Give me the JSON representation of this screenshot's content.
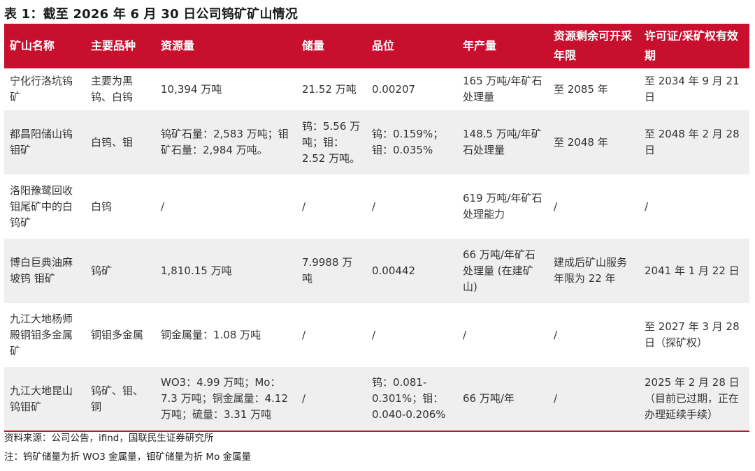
{
  "title": "表 1：截至 2026 年 6 月 30 日公司钨矿矿山情况",
  "table": {
    "headers": [
      "矿山名称",
      "主要品种",
      "资源量",
      "储量",
      "品位",
      "年产量",
      "资源剩余可开采年限",
      "许可证/采矿权有效期"
    ],
    "rows": [
      [
        "宁化行洛坑钨矿",
        "主要为黑钨、白钨",
        "10,394 万吨",
        "21.52 万吨",
        "0.00207",
        "165 万吨/年矿石处理量",
        "至 2085 年",
        "至 2034 年 9 月 21 日"
      ],
      [
        "都昌阳储山钨钼矿",
        "白钨、钼",
        "钨矿石量：2,583 万吨；钼矿石量：2,984 万吨。",
        "钨：5.56 万吨；钼：2.52 万吨。",
        "钨：0.159%；钼：0.035%",
        "148.5 万吨/年矿石处理量",
        "至 2048 年",
        "至 2048 年 2 月 28 日"
      ],
      [
        "洛阳豫鹭回收钼尾矿中的白 钨矿",
        "白钨",
        "/",
        "/",
        "/",
        "619 万吨/年矿石处理能力",
        "/",
        "/"
      ],
      [
        "博白巨典油麻坡钨 钼矿",
        "钨矿",
        "1,810.15 万吨",
        "7.9988 万吨",
        "0.00442",
        "66 万吨/年矿石处理量 (在建矿山)",
        "建成后矿山服务年限为 22 年",
        "2041 年 1 月 22 日"
      ],
      [
        "九江大地杨师殿铜钼多金属矿",
        "铜钼多金属",
        "铜金属量：1.08 万吨",
        "/",
        "/",
        "/",
        "/",
        "至 2027 年 3 月 28 日（探矿权）"
      ],
      [
        "九江大地昆山钨钼矿",
        "钨矿、钼、铜",
        "WO3：4.99 万吨；Mo：7.3 万吨；铜金属量：4.12 万吨；硫量：3.31 万吨",
        "/",
        "钨：0.081-0.301%；钼：0.040-0.206%",
        "66 万吨/年",
        "/",
        "2025 年 2 月 28 日（目前已过期，正在办理延续手续）"
      ]
    ]
  },
  "source": "资料来源：公司公告，ifind，国联民生证券研究所",
  "note": "注：钨矿储量为折 WO3 金属量，钼矿储量为折 Mo 金属量",
  "colors": {
    "header_bg": "#c8102e",
    "stripe_bg": "#efefef"
  }
}
